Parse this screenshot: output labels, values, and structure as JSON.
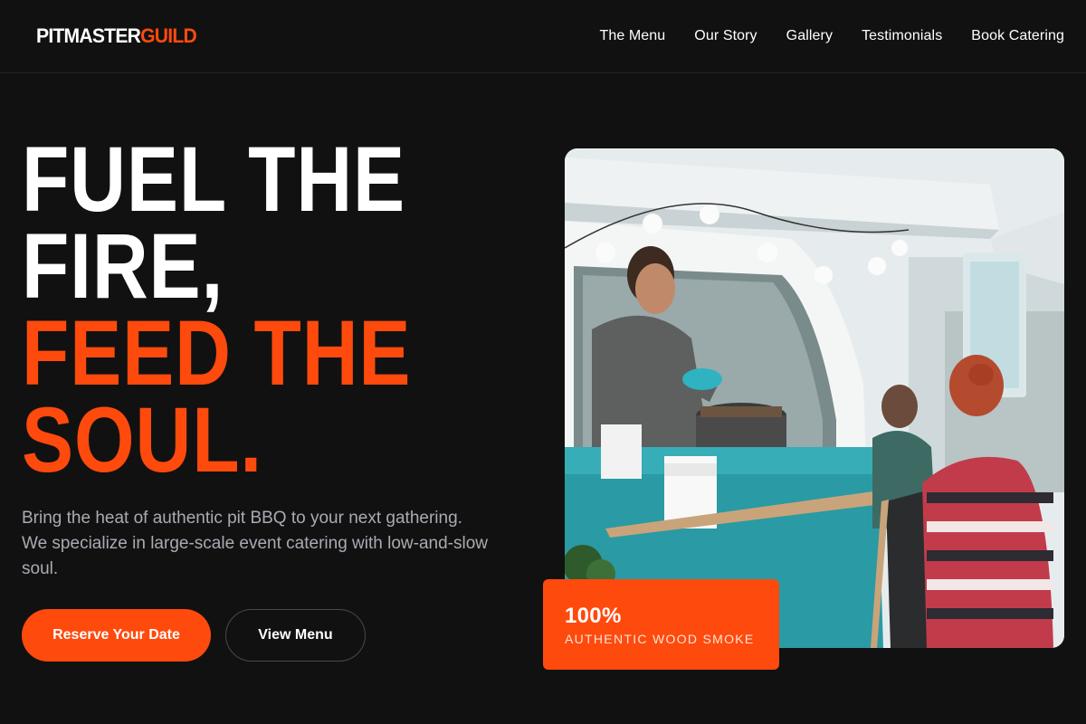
{
  "brand": {
    "name_part1": "PITMASTER",
    "name_part2": "GUILD"
  },
  "nav": {
    "items": [
      {
        "label": "The Menu"
      },
      {
        "label": "Our Story"
      },
      {
        "label": "Gallery"
      },
      {
        "label": "Testimonials"
      },
      {
        "label": "Book Catering"
      }
    ]
  },
  "hero": {
    "headline_white": [
      "FUEL THE",
      "FIRE,"
    ],
    "headline_orange": [
      "FEED THE",
      "SOUL."
    ],
    "subtext": "Bring the heat of authentic pit BBQ to your next gathering. We specialize in large-scale event catering with low-and-slow soul.",
    "primary_button": "Reserve Your Date",
    "secondary_button": "View Menu",
    "image_alt": "Food truck vendor serving customers"
  },
  "stat": {
    "value": "100%",
    "label": "AUTHENTIC WOOD SMOKE"
  },
  "colors": {
    "accent": "#ff4a0d",
    "background": "#111111",
    "text": "#ffffff",
    "muted": "#a9abb3"
  }
}
